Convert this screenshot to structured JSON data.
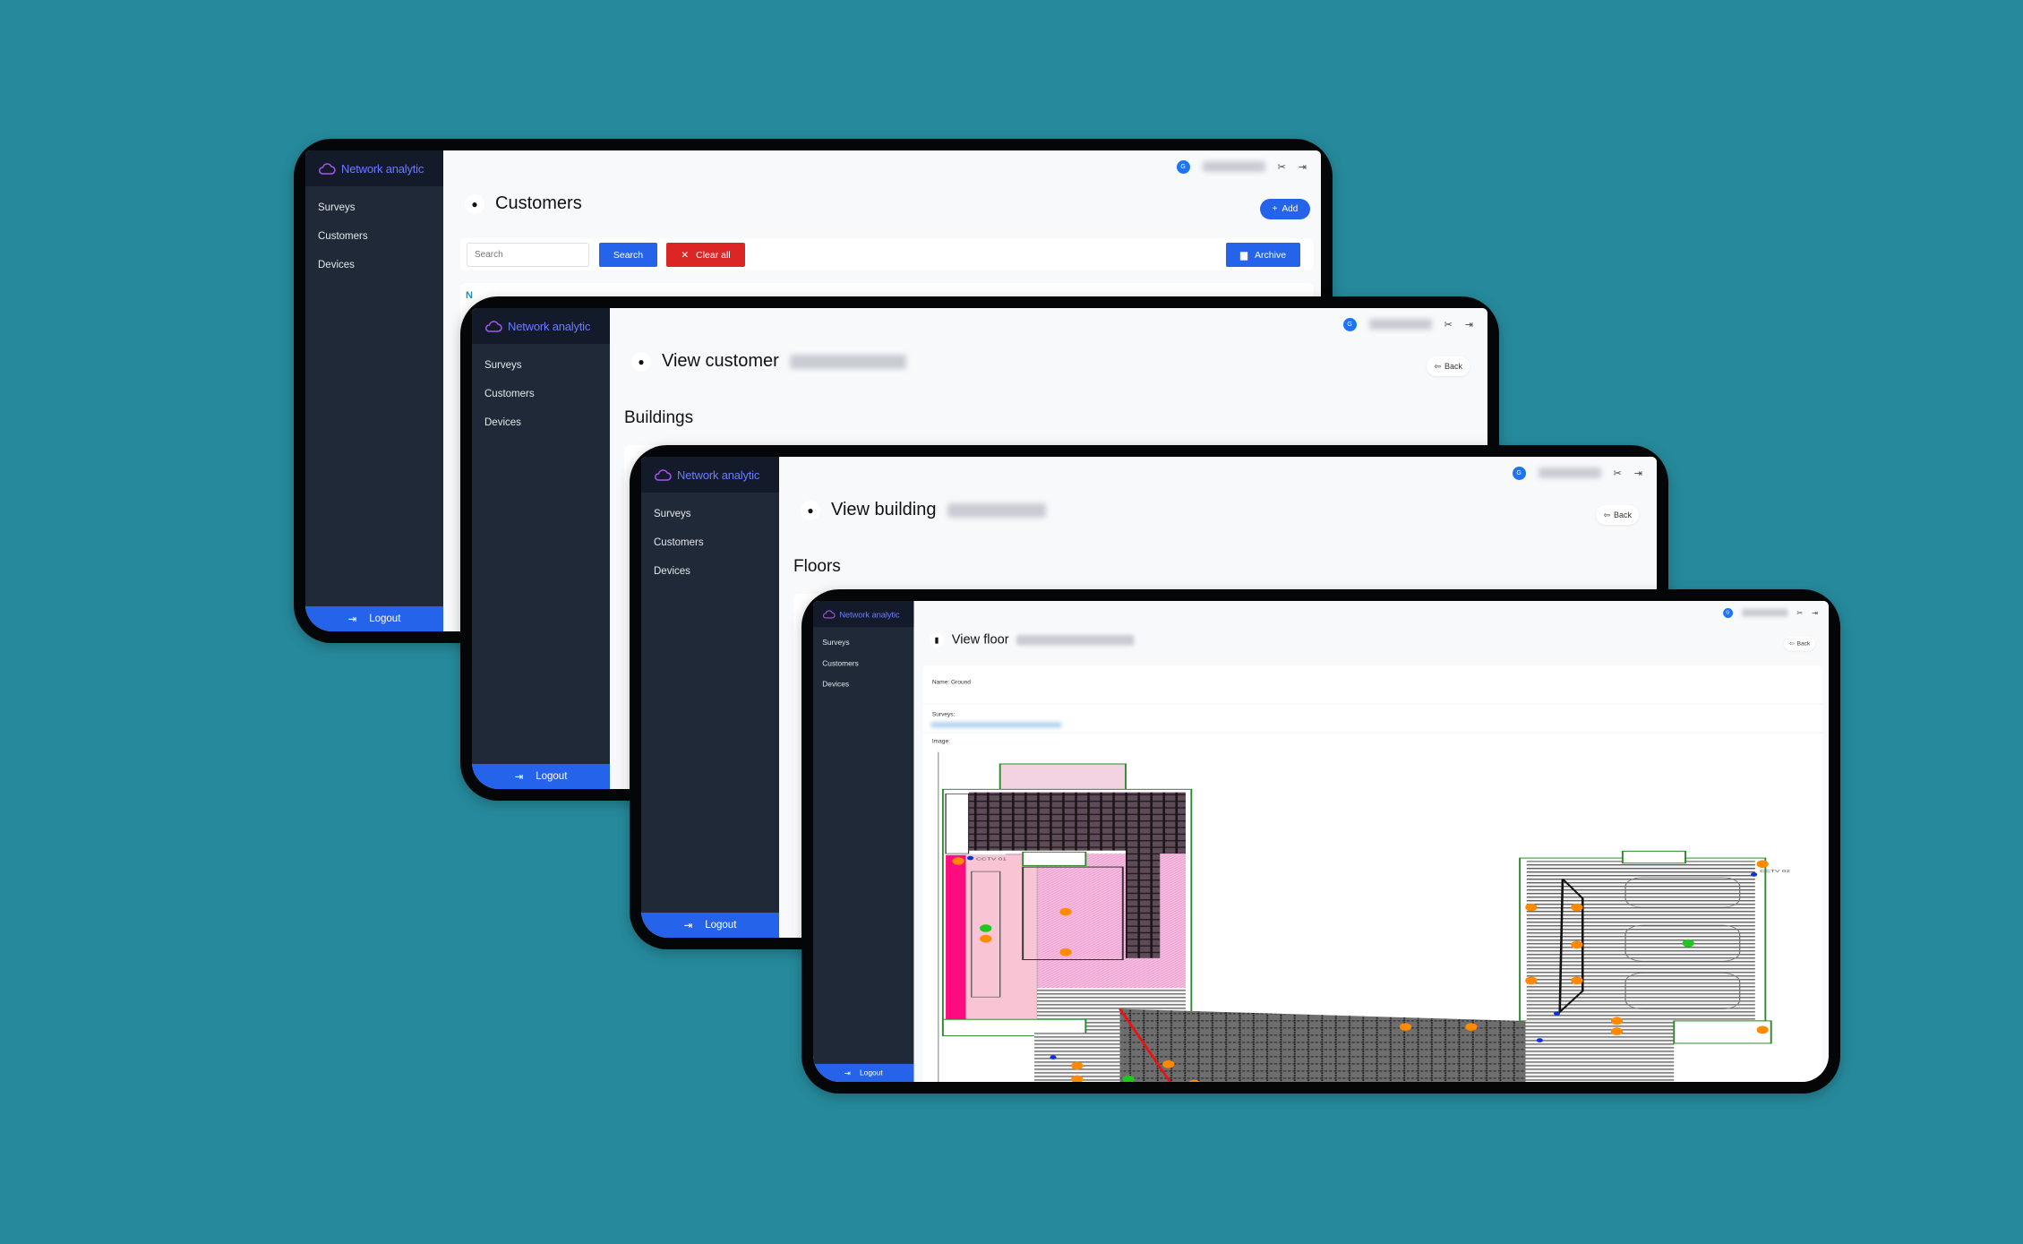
{
  "app": {
    "brand": "Network analytic",
    "nav": [
      {
        "label": "Surveys"
      },
      {
        "label": "Customers"
      },
      {
        "label": "Devices"
      }
    ],
    "logout": "Logout",
    "avatar_initials": "G"
  },
  "colors": {
    "background": "#268a9c",
    "sidebar": "#1f2937",
    "sidebar_header": "#131a2a",
    "primary": "#2563eb",
    "danger": "#dc2626",
    "brand_text": "#6b7cff"
  },
  "icons": {
    "brand": "cloud-icon",
    "title": "user-group-icon",
    "logout": "logout-icon",
    "settings": "tools-icon",
    "back": "arrow-left-icon"
  },
  "screens": {
    "customers": {
      "title": "Customers",
      "add": "Add",
      "search_placeholder": "Search",
      "search": "Search",
      "clear": "Clear all",
      "archive": "Archive",
      "table_header_partial": "N"
    },
    "customer": {
      "title": "View customer",
      "back": "Back",
      "section": "Buildings"
    },
    "building": {
      "title": "View building",
      "back": "Back",
      "section": "Floors"
    },
    "floor": {
      "title": "View floor",
      "back": "Back",
      "name_label": "Name: Ground",
      "surveys_label": "Surveys:",
      "image_label": "Image:",
      "plan_labels": [
        "CCTV 01",
        "CCTV 02"
      ]
    }
  }
}
